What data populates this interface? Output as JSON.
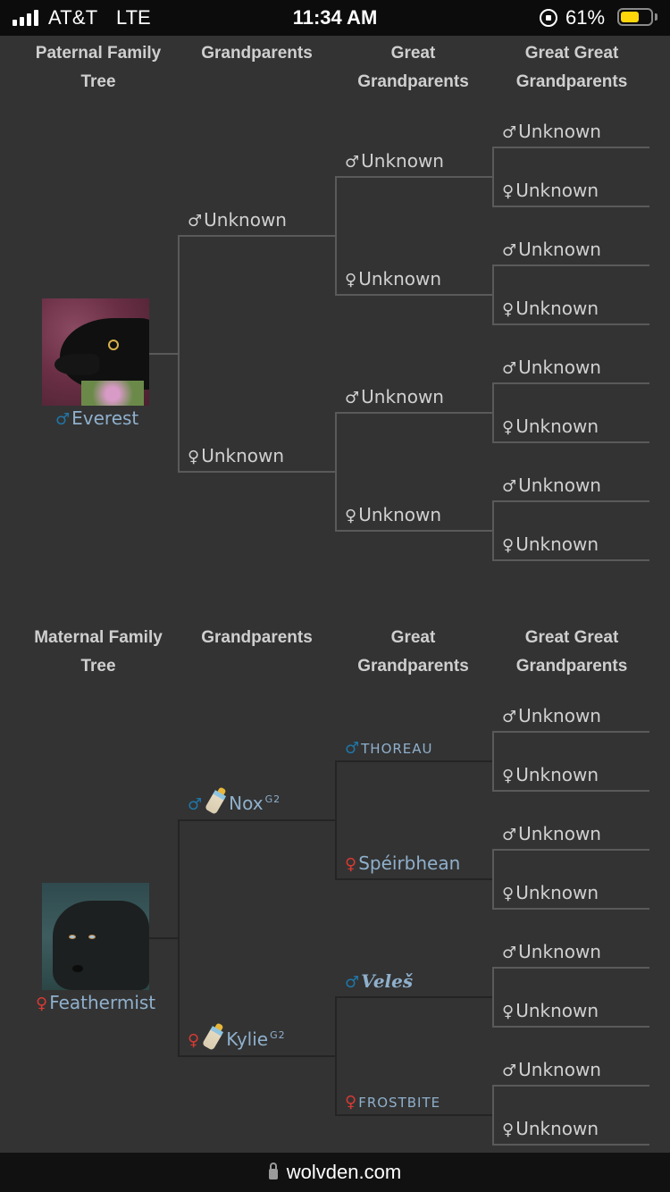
{
  "status_bar": {
    "carrier": "AT&T",
    "network": "LTE",
    "time": "11:34 AM",
    "battery_percent": "61%",
    "battery_level": 0.61,
    "battery_color": "#ffd60a"
  },
  "symbols": {
    "male": "♂",
    "female": "♀"
  },
  "paternal": {
    "headers": [
      "Paternal Family Tree",
      "Grandparents",
      "Great Grandparents",
      "Great Great Grandparents"
    ],
    "subject": {
      "name": "Everest",
      "sex": "male"
    },
    "parents": [
      {
        "name": "Unknown",
        "sex": "male"
      },
      {
        "name": "Unknown",
        "sex": "female"
      }
    ],
    "grandparents": [
      {
        "name": "Unknown",
        "sex": "male"
      },
      {
        "name": "Unknown",
        "sex": "female"
      },
      {
        "name": "Unknown",
        "sex": "male"
      },
      {
        "name": "Unknown",
        "sex": "female"
      }
    ],
    "great_grandparents": [
      {
        "name": "Unknown",
        "sex": "male"
      },
      {
        "name": "Unknown",
        "sex": "female"
      },
      {
        "name": "Unknown",
        "sex": "male"
      },
      {
        "name": "Unknown",
        "sex": "female"
      },
      {
        "name": "Unknown",
        "sex": "male"
      },
      {
        "name": "Unknown",
        "sex": "female"
      },
      {
        "name": "Unknown",
        "sex": "male"
      },
      {
        "name": "Unknown",
        "sex": "female"
      }
    ]
  },
  "maternal": {
    "headers": [
      "Maternal Family Tree",
      "Grandparents",
      "Great Grandparents",
      "Great Great Grandparents"
    ],
    "subject": {
      "name": "Feathermist",
      "sex": "female"
    },
    "parents": [
      {
        "name": "Nox",
        "sex": "male",
        "badge": "G2",
        "icon": "baby-bottle"
      },
      {
        "name": "Kylie",
        "sex": "female",
        "badge": "G2",
        "icon": "baby-bottle"
      }
    ],
    "grandparents": [
      {
        "name": "THOREAU",
        "sex": "male"
      },
      {
        "name": "Spéirbhean",
        "sex": "female"
      },
      {
        "name": "Veleš",
        "sex": "male"
      },
      {
        "name": "FROSTBITE",
        "sex": "female"
      }
    ],
    "great_grandparents": [
      {
        "name": "Unknown",
        "sex": "male"
      },
      {
        "name": "Unknown",
        "sex": "female"
      },
      {
        "name": "Unknown",
        "sex": "male"
      },
      {
        "name": "Unknown",
        "sex": "female"
      },
      {
        "name": "Unknown",
        "sex": "male"
      },
      {
        "name": "Unknown",
        "sex": "female"
      },
      {
        "name": "Unknown",
        "sex": "male"
      },
      {
        "name": "Unknown",
        "sex": "female"
      }
    ]
  },
  "url_bar": {
    "url": "wolvden.com"
  },
  "colors": {
    "background": "#333333",
    "male": "#1f76a8",
    "female": "#d63a34",
    "link_name": "#8fb0cc",
    "unknown": "#d0d0d0"
  }
}
